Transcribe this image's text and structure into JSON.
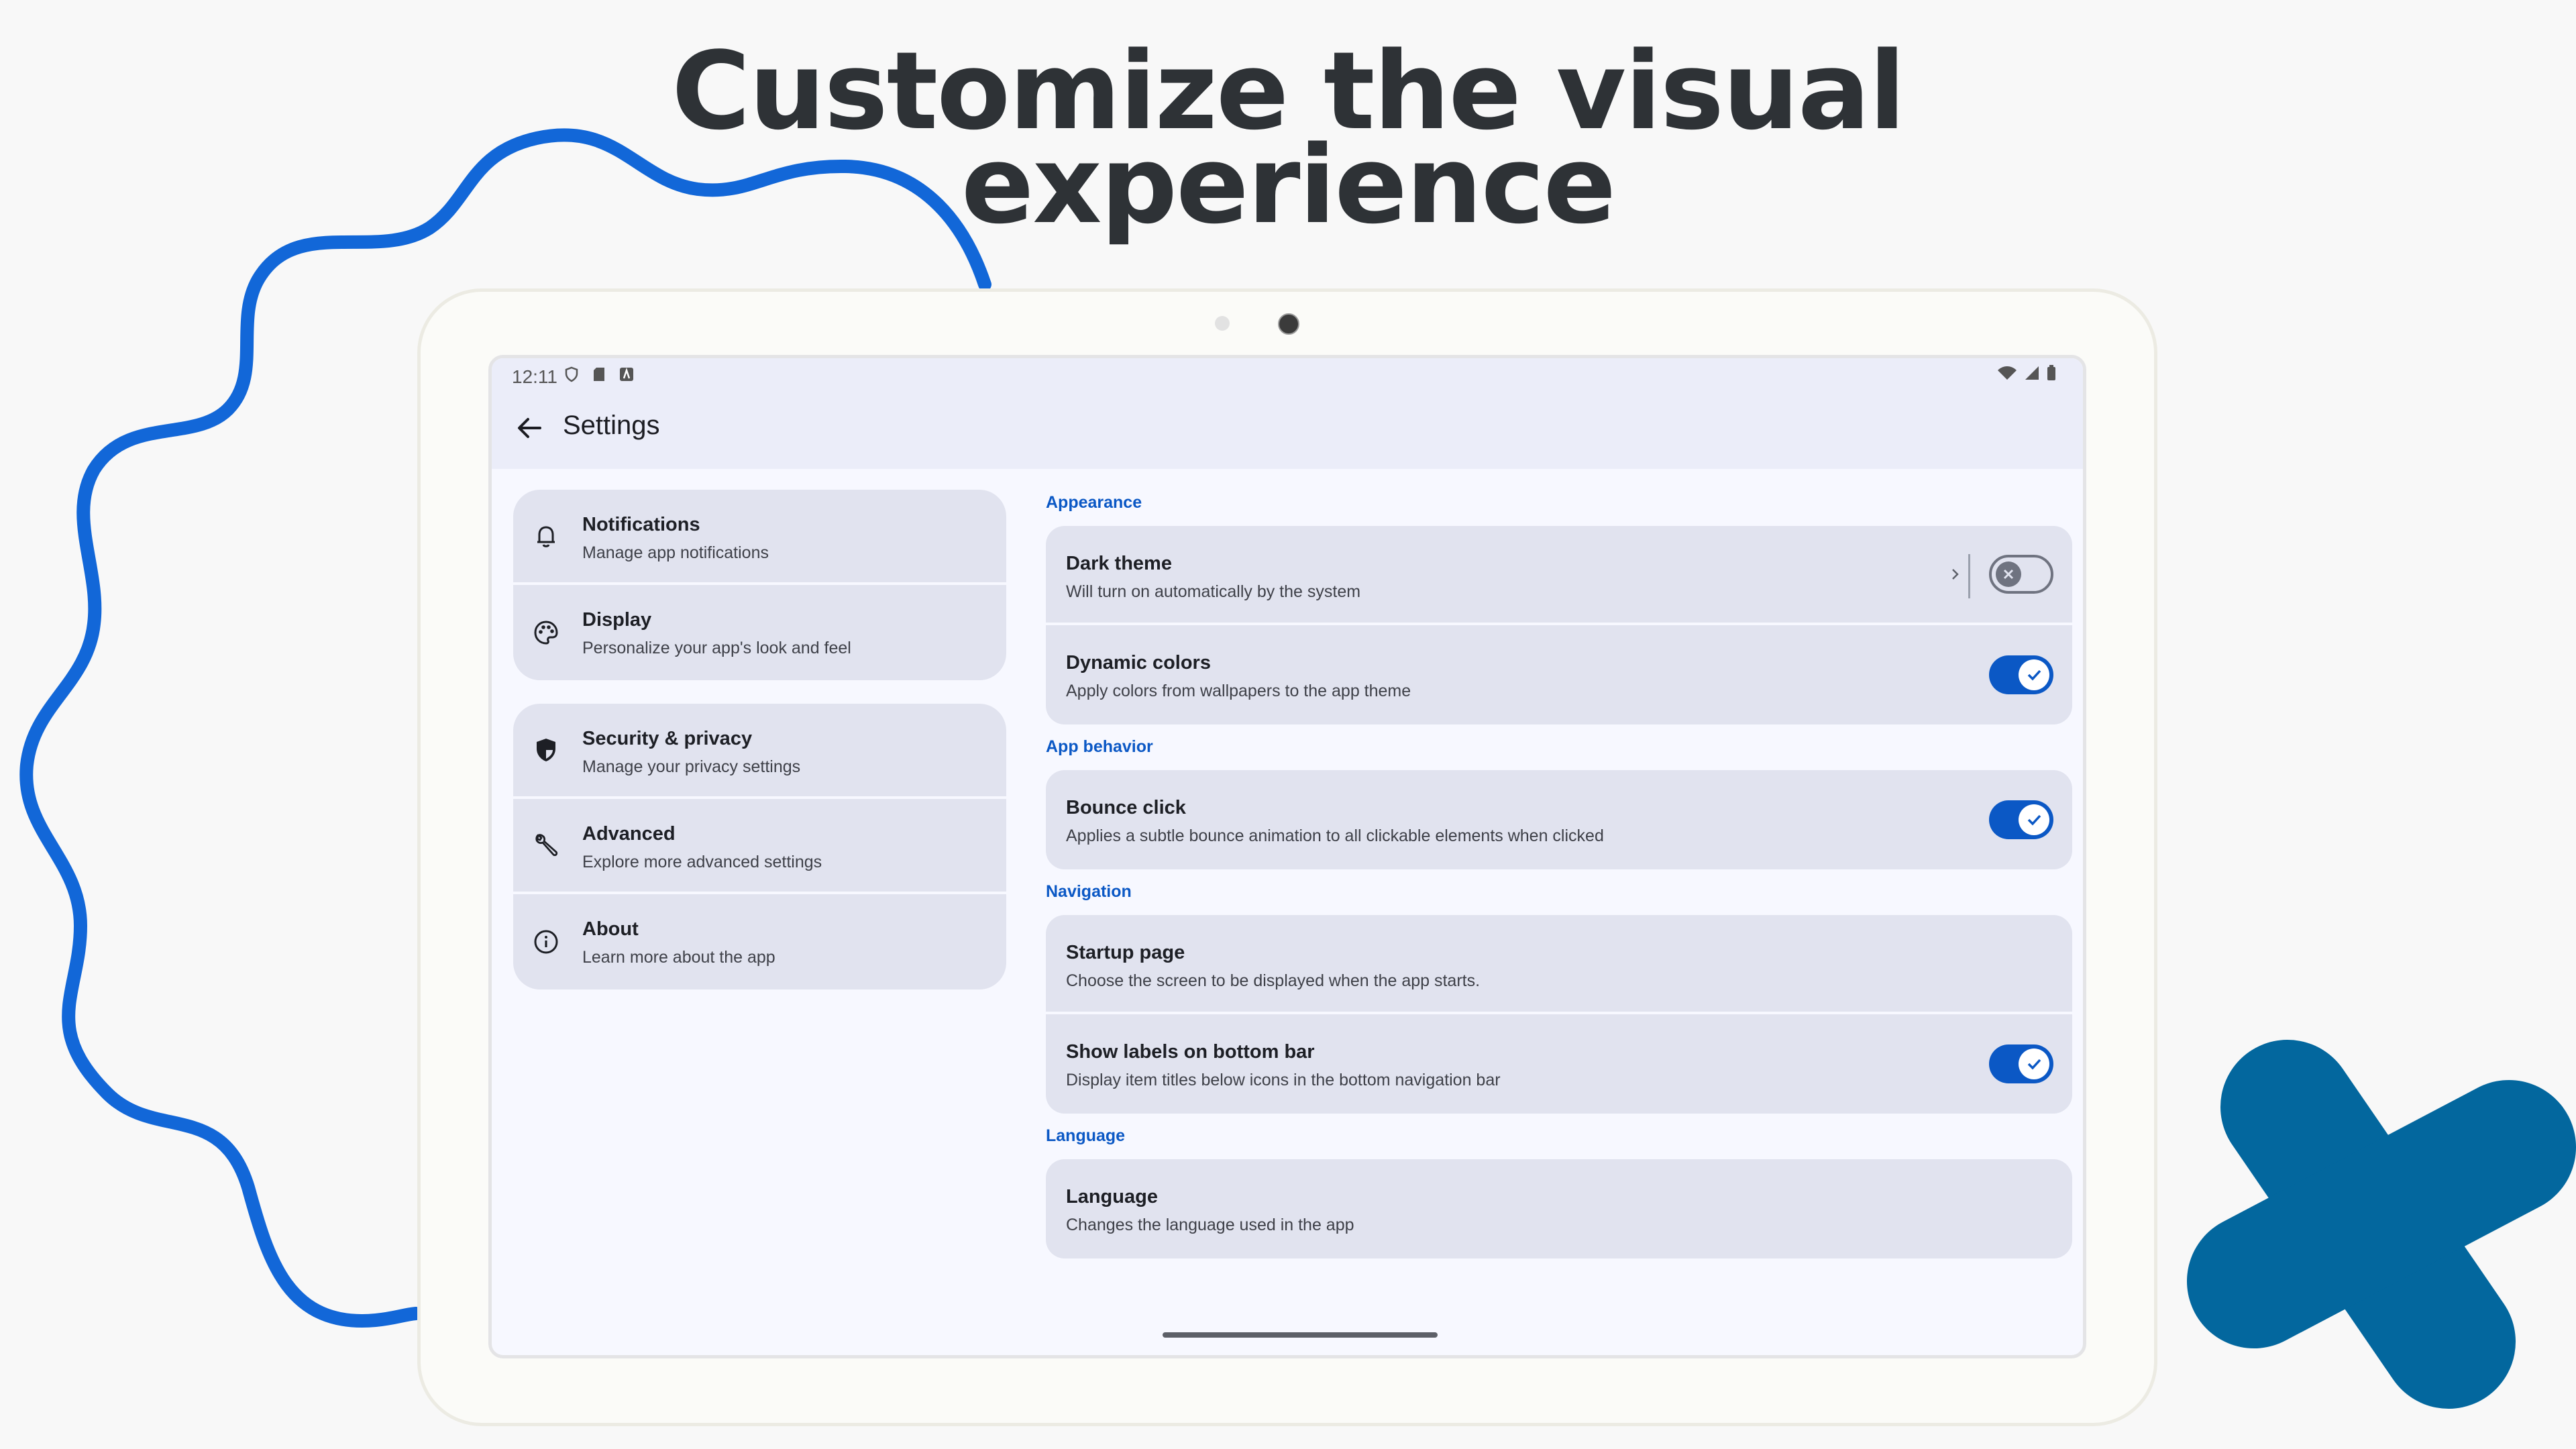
{
  "headline": {
    "line1": "Customize the visual",
    "line2": "experience"
  },
  "colors": {
    "accent": "#0B58C5",
    "deco_wave": "#1267D8",
    "deco_cross": "#03679E",
    "surface": "#E1E3EF",
    "appbar": "#EBEDF9"
  },
  "status_bar": {
    "time": "12:11",
    "left_icons": [
      "shield-icon",
      "sd-card-icon",
      "autofill-icon"
    ],
    "right_icons": [
      "wifi-icon",
      "signal-icon",
      "battery-icon"
    ]
  },
  "app_bar": {
    "back_icon": "arrow-back-icon",
    "title": "Settings"
  },
  "nav": {
    "group1": [
      {
        "icon": "bell-icon",
        "title": "Notifications",
        "subtitle": "Manage app notifications"
      },
      {
        "icon": "palette-icon",
        "title": "Display",
        "subtitle": "Personalize your app's look and feel"
      }
    ],
    "group2": [
      {
        "icon": "shield-icon",
        "title": "Security & privacy",
        "subtitle": "Manage your privacy settings"
      },
      {
        "icon": "wrench-icon",
        "title": "Advanced",
        "subtitle": "Explore more advanced settings"
      },
      {
        "icon": "info-icon",
        "title": "About",
        "subtitle": "Learn more about the app"
      }
    ]
  },
  "sections": {
    "appearance": {
      "label": "Appearance",
      "items": [
        {
          "title": "Dark theme",
          "subtitle": "Will turn on automatically by the system",
          "toggle": false
        },
        {
          "title": "Dynamic colors",
          "subtitle": "Apply colors from wallpapers to the app theme",
          "toggle": true
        }
      ]
    },
    "behavior": {
      "label": "App behavior",
      "items": [
        {
          "title": "Bounce click",
          "subtitle": "Applies a subtle bounce animation to all clickable elements when clicked",
          "toggle": true
        }
      ]
    },
    "navigation": {
      "label": "Navigation",
      "items": [
        {
          "title": "Startup page",
          "subtitle": "Choose the screen to be displayed when the app starts."
        },
        {
          "title": "Show labels on bottom bar",
          "subtitle": "Display item titles below icons in the bottom navigation bar",
          "toggle": true
        }
      ]
    },
    "language": {
      "label": "Language",
      "items": [
        {
          "title": "Language",
          "subtitle": "Changes the language used in the app"
        }
      ]
    }
  }
}
